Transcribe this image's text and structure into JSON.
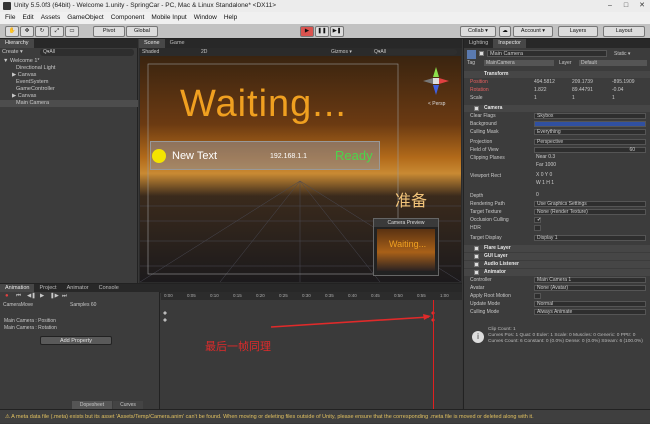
{
  "window": {
    "title": "Unity 5.5.0f3 (64bit) - Welcome 1.unity - SpringCar - PC, Mac & Linux Standalone* <DX11>"
  },
  "menu": [
    "File",
    "Edit",
    "Assets",
    "GameObject",
    "Component",
    "Mobile Input",
    "Window",
    "Help"
  ],
  "toolbar": {
    "pivot": "Pivot",
    "global": "Global",
    "collab": "Collab ▾",
    "account": "Account ▾",
    "layers": "Layers",
    "layout": "Layout"
  },
  "hierarchy": {
    "tab": "Hierarchy",
    "create": "Create ▾",
    "search": "Q▾All",
    "items": [
      {
        "label": "▼ Welcome 1*",
        "selected": false
      },
      {
        "label": "Directional Light",
        "selected": false
      },
      {
        "label": "▶ Canvas",
        "selected": false
      },
      {
        "label": "EventSystem",
        "selected": false
      },
      {
        "label": "GameController",
        "selected": false
      },
      {
        "label": "▶ Canvas",
        "selected": false
      },
      {
        "label": "Main Camera",
        "selected": true
      }
    ]
  },
  "scene": {
    "tabs": [
      "Scene",
      "Game"
    ],
    "shaded": "Shaded",
    "mode2d": "2D",
    "gizmos": "Gizmos ▾",
    "search": "Q▾All",
    "waiting": "Waiting...",
    "newtext": "New Text",
    "ip": "192.168.1.1",
    "ready": "Ready",
    "zhunbei": "准备",
    "persp": "< Persp",
    "preview": "Camera Preview",
    "preview_waiting": "Waiting..."
  },
  "inspector": {
    "tabs": [
      "Lighting",
      "Inspector"
    ],
    "object": "Main Camera",
    "static": "Static ▾",
    "tag": "MainCamera",
    "layer": "Default",
    "rows": [
      {
        "label": "Transform",
        "header": true
      },
      {
        "label": "Position",
        "x": "494.5812",
        "y": "209.1739",
        "z": "-895.1909"
      },
      {
        "label": "Rotation",
        "x": "1.822",
        "y": "89.44791",
        "z": "-0.04"
      },
      {
        "label": "Scale",
        "x": "1",
        "y": "1",
        "z": "1"
      },
      {
        "label": "Camera",
        "header": true
      },
      {
        "label": "Clear Flags",
        "value": "Skybox"
      },
      {
        "label": "Background",
        "value": ""
      },
      {
        "label": "Culling Mask",
        "value": "Everything"
      },
      {
        "label": "Projection",
        "value": "Perspective"
      },
      {
        "label": "Field of View",
        "value": "60"
      },
      {
        "label": "Clipping Planes",
        "value": "Near  0.3"
      },
      {
        "label": "",
        "value": "Far   1000"
      },
      {
        "label": "Viewport Rect",
        "value": "X 0     Y 0"
      },
      {
        "label": "",
        "value": "W 1     H 1"
      },
      {
        "label": "Depth",
        "value": "0"
      },
      {
        "label": "Rendering Path",
        "value": "Use Graphics Settings"
      },
      {
        "label": "Target Texture",
        "value": "None (Render Texture)"
      },
      {
        "label": "Occlusion Culling",
        "value": "✔"
      },
      {
        "label": "HDR",
        "value": ""
      },
      {
        "label": "Target Display",
        "value": "Display 1"
      },
      {
        "label": "Flare Layer",
        "header": true
      },
      {
        "label": "GUI Layer",
        "header": true
      },
      {
        "label": "Audio Listener",
        "header": true
      },
      {
        "label": "Animator",
        "header": true
      },
      {
        "label": "Controller",
        "value": "Main Camera 1"
      },
      {
        "label": "Avatar",
        "value": "None (Avatar)"
      },
      {
        "label": "Apply Root Motion",
        "value": ""
      },
      {
        "label": "Update Mode",
        "value": "Normal"
      },
      {
        "label": "Culling Mode",
        "value": "Always Animate"
      }
    ],
    "clip_info": "Clip Count: 1\nCurves Pos: 1 Quat: 0 Euler: 1 Scale: 0 Muscles: 0 Generic: 0 PPtr: 0\nCurves Count: 6 Constant: 0 (0.0%) Dense: 0 (0.0%) Stream: 6 (100.0%)"
  },
  "animation": {
    "tabs": [
      "Animation",
      "Project",
      "Animator",
      "Console"
    ],
    "clip": "CameraMove",
    "samples": "Samples 60",
    "properties": [
      "Main Camera : Position",
      "Main Camera : Rotation"
    ],
    "add_property": "Add Property",
    "ruler": [
      "0:00",
      "0:05",
      "0:10",
      "0:15",
      "0:20",
      "0:25",
      "0:30",
      "0:35",
      "0:40",
      "0:45",
      "0:50",
      "0:55",
      "1:00"
    ],
    "dopesheet": "Dopesheet",
    "curves": "Curves",
    "note": "最后一帧同理"
  },
  "status": "A meta data file (.meta) exists but its asset 'Assets/Temp/Camera.anim' can't be found. When moving or deleting files outside of Unity, please ensure that the corresponding .meta file is moved or deleted along with it."
}
